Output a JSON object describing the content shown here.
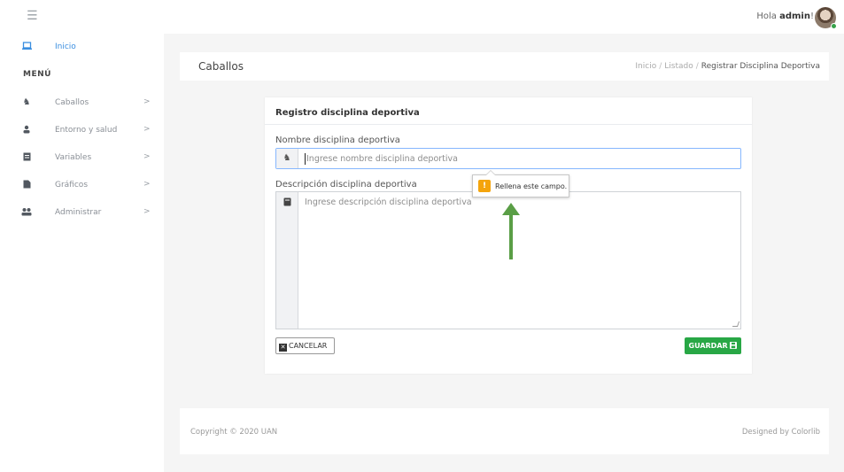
{
  "topbar": {
    "menu_icon": "hamburger-icon",
    "greeting_prefix": "Hola ",
    "user": "admin",
    "greeting_suffix": "!"
  },
  "sidebar": {
    "home_label": "Inicio",
    "menu_heading": "MENÚ",
    "items": [
      {
        "label": "Caballos",
        "icon": "horse-icon"
      },
      {
        "label": "Entorno y salud",
        "icon": "person-icon"
      },
      {
        "label": "Variables",
        "icon": "document-icon"
      },
      {
        "label": "Gráficos",
        "icon": "file-icon"
      },
      {
        "label": "Administrar",
        "icon": "users-icon"
      }
    ],
    "chevron": ">"
  },
  "header": {
    "title": "Caballos",
    "breadcrumb": [
      "Inicio",
      "Listado",
      "Registrar Disciplina Deportiva"
    ],
    "separator": "/"
  },
  "form": {
    "title": "Registro disciplina deportiva",
    "name_label": "Nombre disciplina deportiva",
    "name_placeholder": "Ingrese nombre disciplina deportiva",
    "desc_label": "Descripción disciplina deportiva",
    "desc_placeholder": "Ingrese descripción disciplina deportiva",
    "cancel_label": "CANCELAR",
    "save_label": "GUARDAR"
  },
  "tooltip": {
    "text": "Rellena este campo.",
    "warn_glyph": "!"
  },
  "footer": {
    "copyright": "Copyright © 2020 UAN",
    "designed_by": "Designed by Colorlib"
  },
  "colors": {
    "accent": "#3a8ee0",
    "save": "#28a745",
    "arrow": "#5a9e46",
    "warning": "#f4a40c"
  }
}
